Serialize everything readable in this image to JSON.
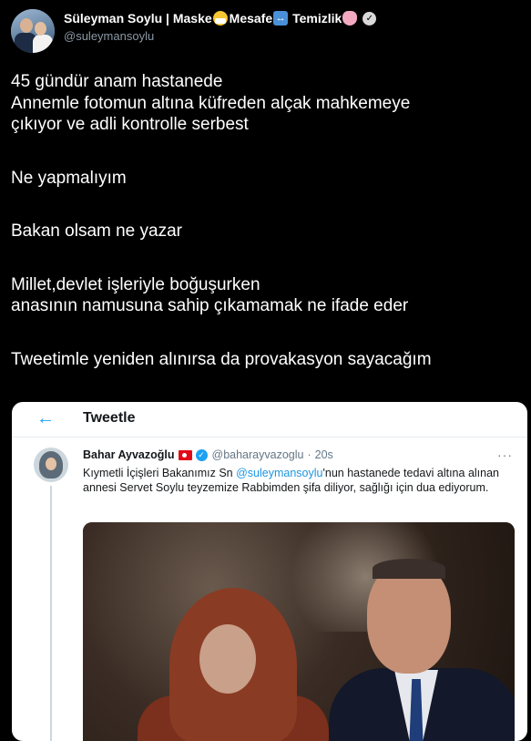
{
  "author": {
    "name_parts": [
      "Süleyman Soylu | Maske",
      "Mesafe",
      "Temizlik"
    ],
    "handle": "@suleymansoylu",
    "icons": [
      "face-with-mask-emoji",
      "left-right-arrow-emoji",
      "soap-emoji",
      "verified-badge-icon",
      "chevron-down-icon"
    ]
  },
  "tweet": {
    "paragraphs": [
      [
        "45 gündür anam hastanede",
        "Annemle fotomun altına küfreden alçak mahkemeye",
        "çıkıyor ve adli kontrolle serbest"
      ],
      [
        "Ne yapmalıyım"
      ],
      [
        "Bakan olsam ne yazar"
      ],
      [
        "Millet,devlet işleriyle boğuşurken",
        "anasının namusuna sahip çıkamamak ne ifade eder"
      ],
      [
        "Tweetimle yeniden alınırsa da provakasyon sayacağım"
      ]
    ]
  },
  "embed": {
    "header_title": "Tweetle",
    "back_icon": "←",
    "quoted": {
      "name": "Bahar Ayvazoğlu",
      "handle": "@baharayvazoglu",
      "separator": "·",
      "time": "20s",
      "more": "···",
      "text_before": "Kıymetli İçişleri Bakanımız Sn ",
      "mention": "@suleymansoylu",
      "text_after": "'nun hastanede tedavi altına alınan annesi Servet Soylu teyzemize Rabbimden şifa diliyor, sağlığı için dua ediyorum."
    }
  },
  "colors": {
    "background": "#000000",
    "text": "#ffffff",
    "handle": "#8b98a5",
    "accent": "#1da1f2"
  }
}
